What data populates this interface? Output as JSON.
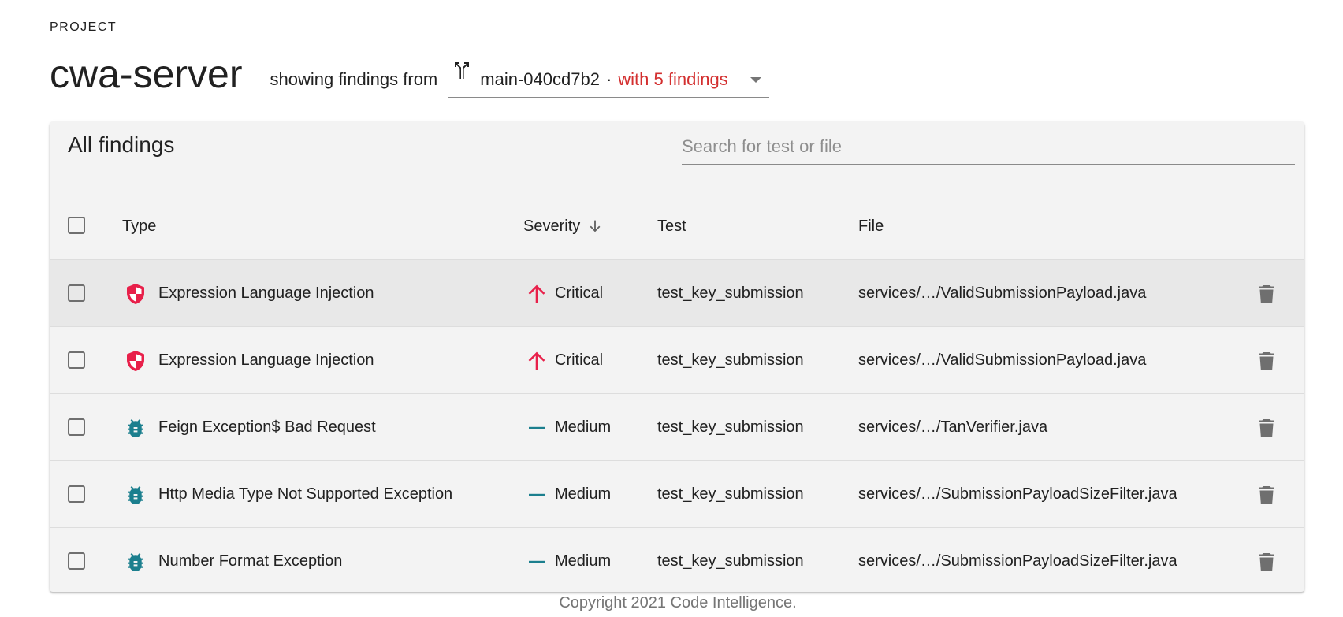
{
  "header": {
    "project_label": "PROJECT",
    "project_name": "cwa-server",
    "showing_text": "showing findings from",
    "branch": {
      "name": "main-040cd7b2",
      "separator": "·",
      "findings_text": "with 5 findings",
      "findings_color": "#d32f2f"
    }
  },
  "card": {
    "title": "All findings",
    "search": {
      "placeholder": "Search for test or file",
      "value": ""
    }
  },
  "table": {
    "columns": {
      "type": "Type",
      "severity": "Severity",
      "test": "Test",
      "file": "File"
    },
    "sort": {
      "column": "severity",
      "direction": "descending"
    },
    "rows": [
      {
        "type": "Expression Language Injection",
        "type_icon": "shield-icon",
        "severity": "Critical",
        "severity_icon": "arrow-up-icon",
        "test": "test_key_submission",
        "file": "services/…/ValidSubmissionPayload.java",
        "selected": false
      },
      {
        "type": "Expression Language Injection",
        "type_icon": "shield-icon",
        "severity": "Critical",
        "severity_icon": "arrow-up-icon",
        "test": "test_key_submission",
        "file": "services/…/ValidSubmissionPayload.java",
        "selected": false
      },
      {
        "type": "Feign Exception$ Bad Request",
        "type_icon": "bug-icon",
        "severity": "Medium",
        "severity_icon": "dash-icon",
        "test": "test_key_submission",
        "file": "services/…/TanVerifier.java",
        "selected": false
      },
      {
        "type": "Http Media Type Not Supported Exception",
        "type_icon": "bug-icon",
        "severity": "Medium",
        "severity_icon": "dash-icon",
        "test": "test_key_submission",
        "file": "services/…/SubmissionPayloadSizeFilter.java",
        "selected": false
      },
      {
        "type": "Number Format Exception",
        "type_icon": "bug-icon",
        "severity": "Medium",
        "severity_icon": "dash-icon",
        "test": "test_key_submission",
        "file": "services/…/SubmissionPayloadSizeFilter.java",
        "selected": false
      }
    ]
  },
  "colors": {
    "critical": "#e8204a",
    "medium": "#1b7f8e",
    "card_background": "#f3f3f3",
    "icon_gray": "#6f6f6f"
  },
  "footer": {
    "copyright": "Copyright 2021 Code Intelligence."
  }
}
